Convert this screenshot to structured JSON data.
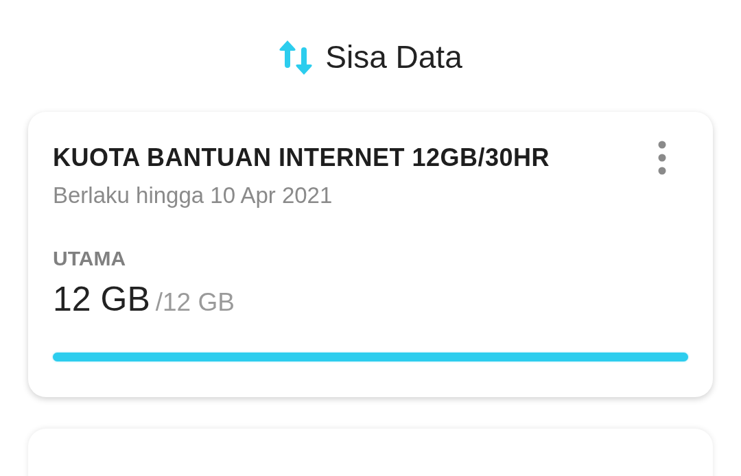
{
  "header": {
    "title": "Sisa Data"
  },
  "cards": [
    {
      "title": "KUOTA BANTUAN INTERNET 12GB/30HR",
      "validity": "Berlaku hingga 10 Apr 2021",
      "quota_label": "UTAMA",
      "remaining": "12 GB",
      "total": "/12 GB",
      "level": 1.0
    }
  ]
}
